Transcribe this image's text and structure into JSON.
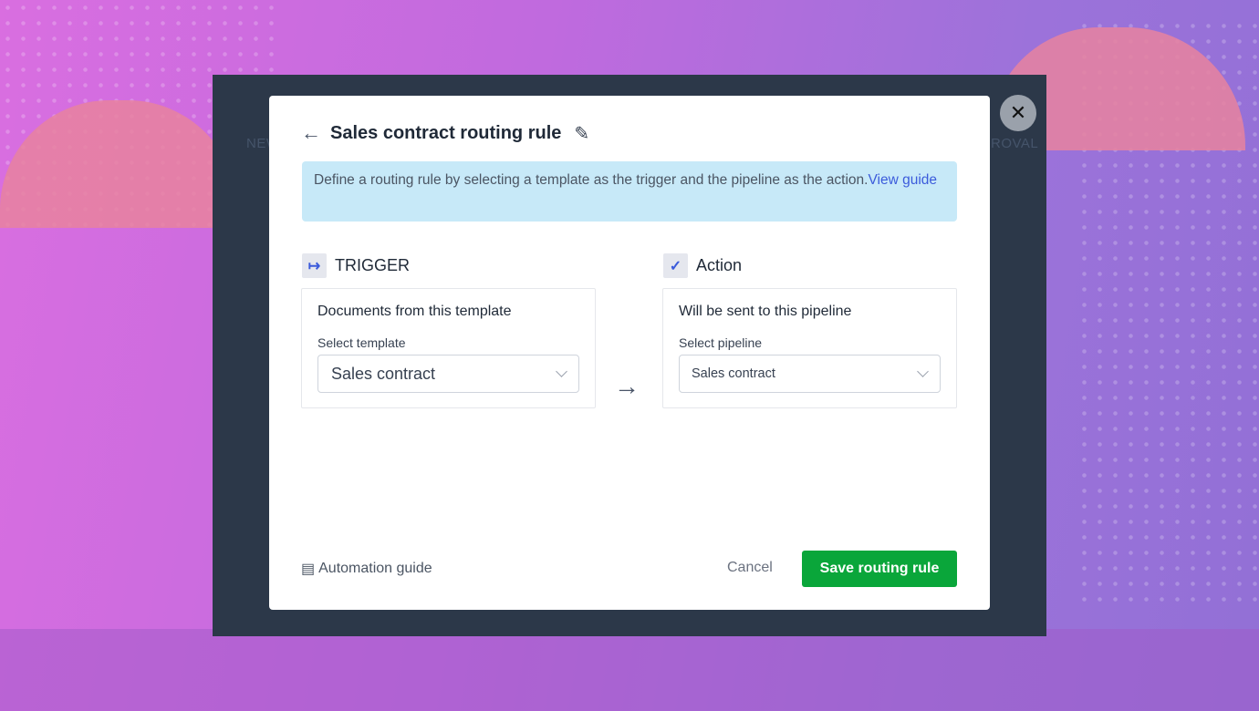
{
  "background": {
    "tab_left": "NEW",
    "tab_right": "ROVAL"
  },
  "dialog": {
    "title": "Sales contract routing rule",
    "info_text": "Define a routing rule by selecting a template as the trigger and the pipeline as the action.",
    "info_link": "View guide",
    "trigger": {
      "heading": "TRIGGER",
      "card_title": "Documents from this template",
      "label": "Select template",
      "value": "Sales contract"
    },
    "action": {
      "heading": "Action",
      "card_title": "Will be sent to this pipeline",
      "label": "Select pipeline",
      "value": "Sales contract"
    },
    "footer": {
      "guide": "Automation guide",
      "cancel": "Cancel",
      "save": "Save routing rule"
    }
  },
  "colors": {
    "primary": "#0aa63a",
    "accent": "#3b5bdb",
    "info_bg": "#c7e9f8"
  }
}
